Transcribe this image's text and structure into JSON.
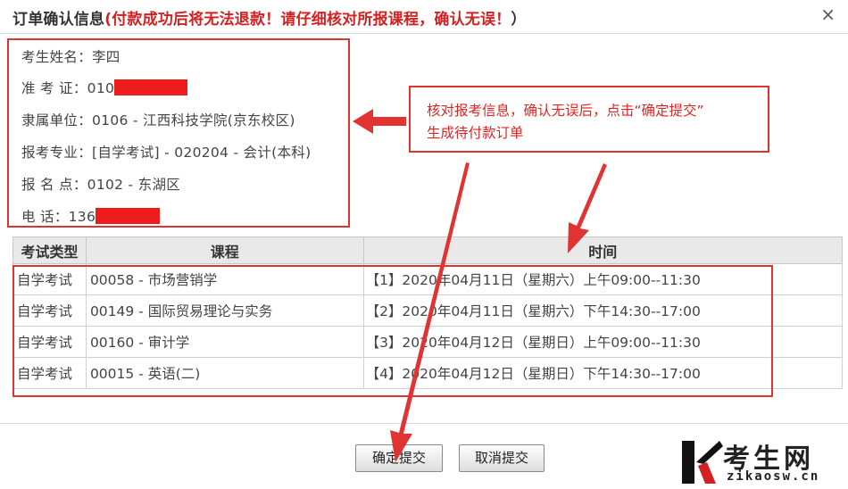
{
  "title": {
    "prefix": "订单确认信息",
    "warning": "(付款成功后将无法退款！请仔细核对所报课程，确认无误！",
    "suffix": "）",
    "close": "×"
  },
  "info": {
    "name": "考生姓名：李四",
    "ticket": "准 考 证：010",
    "unit": "隶属单位：0106 - 江西科技学院(京东校区)",
    "major": "报考专业：[自学考试] - 020204 - 会计(本科)",
    "location": "报 名 点：0102 - 东湖区",
    "phone": "电   话：136"
  },
  "callout": {
    "line1": "核对报考信息，确认无误后，点击“确定提交”",
    "line2": "生成待付款订单"
  },
  "table": {
    "headers": [
      "考试类型",
      "课程",
      "时间"
    ],
    "rows": [
      {
        "type": "自学考试",
        "course": "00058 - 市场营销学",
        "time": "【1】2020年04月11日（星期六）上午09:00--11:30"
      },
      {
        "type": "自学考试",
        "course": "00149 - 国际贸易理论与实务",
        "time": "【2】2020年04月11日（星期六）下午14:30--17:00"
      },
      {
        "type": "自学考试",
        "course": "00160 - 审计学",
        "time": "【3】2020年04月12日（星期日）上午09:00--11:30"
      },
      {
        "type": "自学考试",
        "course": "00015 - 英语(二)",
        "time": "【4】2020年04月12日（星期日）下午14:30--17:00"
      }
    ]
  },
  "buttons": {
    "confirm": "确定提交",
    "cancel": "取消提交"
  },
  "watermark": {
    "cn": "考生网",
    "en": "zikaosw.cn"
  },
  "colors": {
    "accent": "#d33333",
    "redact": "#ee1c1c"
  }
}
